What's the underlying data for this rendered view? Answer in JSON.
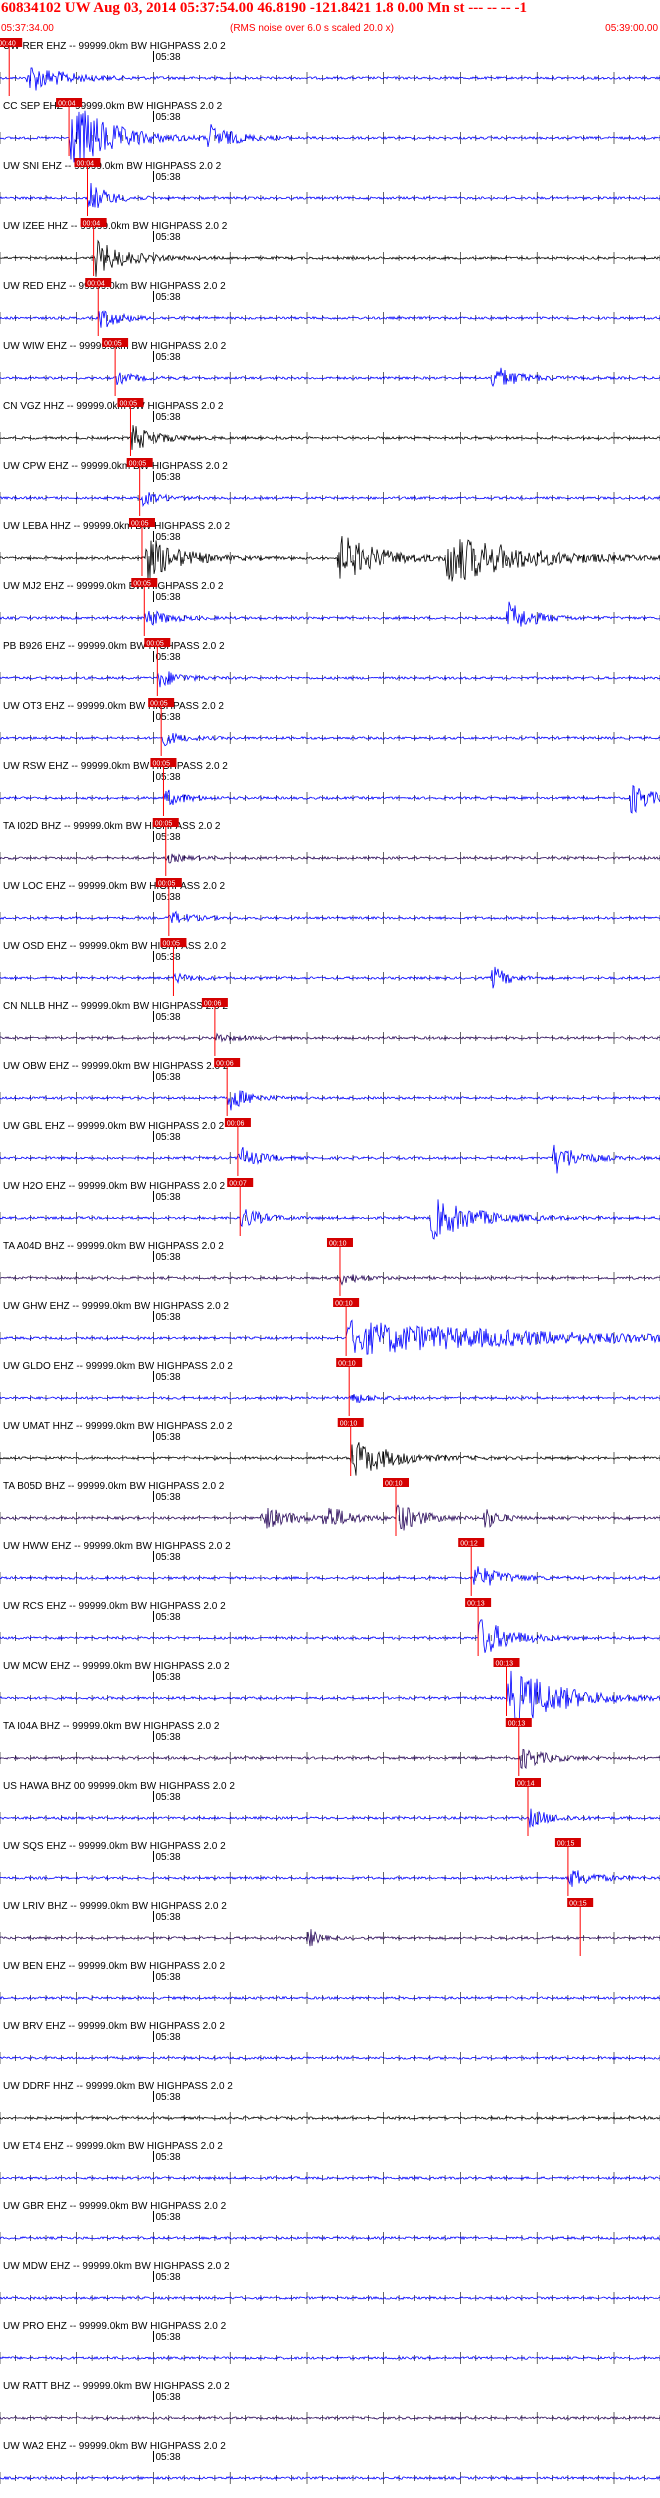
{
  "header": {
    "title": "60834102 UW Aug 03, 2014 05:37:54.00  46.8190 -121.8421  1.8 0.00 Mn st --- -- --  -1",
    "start_time": "05:37:34.00",
    "note": "(RMS noise over 6.0 s scaled 20.0 x)",
    "end_time": "05:39:00.00"
  },
  "colors": {
    "pick": "#ff0000",
    "pick_fill": "#d40000",
    "grid": "#000000",
    "traces": {
      "blue": "#0000ff",
      "black": "#000000",
      "purple": "#2a0a5c"
    }
  },
  "chart_data": {
    "type": "line",
    "title": "60834102 UW Aug 03, 2014 05:37:54.00  46.8190 -121.8421  1.8 0.00 Mn st --- -- --  -1",
    "x_range": [
      "05:37:34.00",
      "05:39:00.00"
    ],
    "tick_label": "05:38",
    "grid": "vertical ticks every 2 s, labeled minute mark",
    "channels": [
      {
        "label": "UW RER EHZ -- 99999.0km BW  HIGHPASS  2.0  2",
        "pick": "00:40",
        "pick_s": 1.2,
        "color": "blue",
        "events": [
          {
            "t": 3.5,
            "amp": 1.0,
            "dur": 7
          }
        ]
      },
      {
        "label": "CC SEP EHZ -- 99999.0km BW  HIGHPASS  2.0  2",
        "pick": "00:04",
        "pick_s": 9.0,
        "color": "blue",
        "events": [
          {
            "t": 9.0,
            "amp": 2.6,
            "dur": 8
          },
          {
            "t": 27,
            "amp": 0.9,
            "dur": 5
          }
        ]
      },
      {
        "label": "UW SNI EHZ -- 99999.0km BW  HIGHPASS  2.0  2",
        "pick": "00:04",
        "pick_s": 11.4,
        "color": "blue",
        "events": [
          {
            "t": 11.4,
            "amp": 1.1,
            "dur": 4
          }
        ]
      },
      {
        "label": "UW IZEE HHZ -- 99999.0km BW  HIGHPASS  2.0  2",
        "pick": "00:04",
        "pick_s": 12.2,
        "color": "black",
        "events": [
          {
            "t": 12.2,
            "amp": 1.2,
            "dur": 6
          }
        ]
      },
      {
        "label": "UW RED EHZ -- 99999.0km BW  HIGHPASS  2.0  2",
        "pick": "00:04",
        "pick_s": 12.8,
        "color": "blue",
        "events": [
          {
            "t": 12.8,
            "amp": 0.8,
            "dur": 4
          }
        ]
      },
      {
        "label": "UW WIW EHZ -- 99999.0km BW  HIGHPASS  2.0  2",
        "pick": "00:05",
        "pick_s": 15.0,
        "color": "blue",
        "events": [
          {
            "t": 15.0,
            "amp": 0.4,
            "dur": 4
          },
          {
            "t": 64,
            "amp": 0.9,
            "dur": 5
          }
        ]
      },
      {
        "label": "CN VGZ HHZ -- 99999.0km BW  HIGHPASS  2.0  2",
        "pick": "00:05",
        "pick_s": 17.0,
        "color": "black",
        "events": [
          {
            "t": 17.0,
            "amp": 0.9,
            "dur": 5
          }
        ]
      },
      {
        "label": "UW CPW EHZ -- 99999.0km BW  HIGHPASS  2.0  2",
        "pick": "00:05",
        "pick_s": 18.2,
        "color": "blue",
        "events": [
          {
            "t": 18.2,
            "amp": 0.5,
            "dur": 4
          }
        ]
      },
      {
        "label": "UW LEBA HHZ -- 99999.0km BW  HIGHPASS  2.0  2",
        "pick": "00:05",
        "pick_s": 18.5,
        "color": "black",
        "events": [
          {
            "t": 18.5,
            "amp": 1.6,
            "dur": 7
          },
          {
            "t": 44,
            "amp": 1.6,
            "dur": 8
          },
          {
            "t": 58,
            "amp": 1.7,
            "dur": 15
          }
        ]
      },
      {
        "label": "UW MJ2 EHZ -- 99999.0km BW  HIGHPASS  2.0  2",
        "pick": "00:05",
        "pick_s": 18.8,
        "color": "blue",
        "events": [
          {
            "t": 18.8,
            "amp": 0.6,
            "dur": 5
          },
          {
            "t": 66,
            "amp": 1.1,
            "dur": 5
          }
        ]
      },
      {
        "label": "PB B926 EHZ -- 99999.0km BW  HIGHPASS  2.0  2",
        "pick": "00:05",
        "pick_s": 20.5,
        "color": "blue",
        "events": [
          {
            "t": 20.5,
            "amp": 0.7,
            "dur": 4
          }
        ]
      },
      {
        "label": "UW OT3 EHZ -- 99999.0km BW  HIGHPASS  2.0  2",
        "pick": "00:05",
        "pick_s": 21.0,
        "color": "blue",
        "events": [
          {
            "t": 21.0,
            "amp": 0.5,
            "dur": 4
          }
        ]
      },
      {
        "label": "UW RSW EHZ -- 99999.0km BW  HIGHPASS  2.0  2",
        "pick": "00:05",
        "pick_s": 21.3,
        "color": "blue",
        "events": [
          {
            "t": 21.3,
            "amp": 0.6,
            "dur": 4
          },
          {
            "t": 82,
            "amp": 1.2,
            "dur": 4
          }
        ]
      },
      {
        "label": "TA I02D BHZ -- 99999.0km BW  HIGHPASS  2.0  2",
        "pick": "00:05",
        "pick_s": 21.6,
        "color": "purple",
        "events": [
          {
            "t": 21.6,
            "amp": 0.3,
            "dur": 4
          }
        ]
      },
      {
        "label": "UW LOC EHZ -- 99999.0km BW  HIGHPASS  2.0  2",
        "pick": "00:05",
        "pick_s": 22.0,
        "color": "blue",
        "events": [
          {
            "t": 22.0,
            "amp": 0.5,
            "dur": 4
          }
        ]
      },
      {
        "label": "UW OSD EHZ -- 99999.0km BW  HIGHPASS  2.0  2",
        "pick": "00:05",
        "pick_s": 22.6,
        "color": "blue",
        "events": [
          {
            "t": 22.6,
            "amp": 0.3,
            "dur": 4
          },
          {
            "t": 64,
            "amp": 0.9,
            "dur": 3
          }
        ]
      },
      {
        "label": "CN NLLB HHZ -- 99999.0km BW  HIGHPASS  2.0  2",
        "pick": "00:06",
        "pick_s": 28.0,
        "color": "purple",
        "events": [
          {
            "t": 28.0,
            "amp": 0.3,
            "dur": 4
          }
        ]
      },
      {
        "label": "UW OBW EHZ -- 99999.0km BW  HIGHPASS  2.0  2",
        "pick": "00:06",
        "pick_s": 29.6,
        "color": "blue",
        "events": [
          {
            "t": 29.6,
            "amp": 0.9,
            "dur": 4
          }
        ]
      },
      {
        "label": "UW GBL EHZ -- 99999.0km BW  HIGHPASS  2.0  2",
        "pick": "00:06",
        "pick_s": 31.0,
        "color": "blue",
        "events": [
          {
            "t": 31.0,
            "amp": 0.8,
            "dur": 4
          },
          {
            "t": 72,
            "amp": 1.1,
            "dur": 5
          }
        ]
      },
      {
        "label": "UW H2O EHZ -- 99999.0km BW  HIGHPASS  2.0  2",
        "pick": "00:07",
        "pick_s": 31.3,
        "color": "blue",
        "events": [
          {
            "t": 31.3,
            "amp": 0.8,
            "dur": 4
          },
          {
            "t": 56,
            "amp": 1.4,
            "dur": 9
          }
        ]
      },
      {
        "label": "TA A04D BHZ -- 99999.0km BW  HIGHPASS  2.0  2",
        "pick": "00:10",
        "pick_s": 44.3,
        "color": "purple",
        "events": [
          {
            "t": 44.3,
            "amp": 0.4,
            "dur": 4
          }
        ]
      },
      {
        "label": "UW GHW EHZ -- 99999.0km BW  HIGHPASS  2.0  2",
        "pick": "00:10",
        "pick_s": 45.1,
        "color": "blue",
        "events": [
          {
            "t": 45.1,
            "amp": 1.1,
            "dur": 40
          }
        ]
      },
      {
        "label": "UW GLDO EHZ -- 99999.0km BW  HIGHPASS  2.0  2",
        "pick": "00:10",
        "pick_s": 45.5,
        "color": "blue",
        "events": [
          {
            "t": 45.5,
            "amp": 0.4,
            "dur": 4
          }
        ]
      },
      {
        "label": "UW UMAT HHZ -- 99999.0km BW  HIGHPASS  2.0  2",
        "pick": "00:10",
        "pick_s": 45.7,
        "color": "black",
        "events": [
          {
            "t": 45.7,
            "amp": 1.3,
            "dur": 8
          }
        ]
      },
      {
        "label": "TA B05D BHZ -- 99999.0km BW  HIGHPASS  2.0  2",
        "pick": "00:10",
        "pick_s": 51.6,
        "color": "purple",
        "events": [
          {
            "t": 34,
            "amp": 0.8,
            "dur": 6
          },
          {
            "t": 42,
            "amp": 0.9,
            "dur": 5
          },
          {
            "t": 51.6,
            "amp": 1.0,
            "dur": 5
          },
          {
            "t": 63,
            "amp": 0.8,
            "dur": 3
          }
        ]
      },
      {
        "label": "UW HWW EHZ -- 99999.0km BW  HIGHPASS  2.0  2",
        "pick": "00:12",
        "pick_s": 61.4,
        "color": "blue",
        "events": [
          {
            "t": 61.4,
            "amp": 0.9,
            "dur": 6
          }
        ]
      },
      {
        "label": "UW RCS EHZ -- 99999.0km BW  HIGHPASS  2.0  2",
        "pick": "00:13",
        "pick_s": 62.3,
        "color": "blue",
        "events": [
          {
            "t": 62.3,
            "amp": 1.4,
            "dur": 6
          }
        ]
      },
      {
        "label": "UW MCW EHZ -- 99999.0km BW  HIGHPASS  2.0  2",
        "pick": "00:13",
        "pick_s": 66.0,
        "color": "blue",
        "events": [
          {
            "t": 66.0,
            "amp": 2.2,
            "dur": 10
          }
        ]
      },
      {
        "label": "TA I04A BHZ -- 99999.0km BW  HIGHPASS  2.0  2",
        "pick": "00:13",
        "pick_s": 67.6,
        "color": "purple",
        "events": [
          {
            "t": 67.6,
            "amp": 0.8,
            "dur": 5
          }
        ]
      },
      {
        "label": "US HAWA BHZ 00 99999.0km BW  HIGHPASS  2.0  2",
        "pick": "00:14",
        "pick_s": 68.8,
        "color": "blue",
        "events": [
          {
            "t": 68.8,
            "amp": 0.6,
            "dur": 5
          }
        ]
      },
      {
        "label": "UW SQS EHZ -- 99999.0km BW  HIGHPASS  2.0  2",
        "pick": "00:15",
        "pick_s": 74.0,
        "color": "blue",
        "events": [
          {
            "t": 74.0,
            "amp": 0.7,
            "dur": 5
          }
        ]
      },
      {
        "label": "UW LRIV BHZ -- 99999.0km BW  HIGHPASS  2.0  2",
        "pick": "00:15",
        "pick_s": 75.6,
        "color": "purple",
        "events": [
          {
            "t": 40,
            "amp": 0.8,
            "dur": 2
          }
        ]
      },
      {
        "label": "UW BEN EHZ -- 99999.0km BW  HIGHPASS  2.0  2",
        "pick": "",
        "pick_s": null,
        "color": "blue",
        "events": []
      },
      {
        "label": "UW BRV EHZ -- 99999.0km BW  HIGHPASS  2.0  2",
        "pick": "",
        "pick_s": null,
        "color": "blue",
        "events": []
      },
      {
        "label": "UW DDRF HHZ -- 99999.0km BW  HIGHPASS  2.0  2",
        "pick": "",
        "pick_s": null,
        "color": "black",
        "events": []
      },
      {
        "label": "UW ET4 EHZ -- 99999.0km BW  HIGHPASS  2.0  2",
        "pick": "",
        "pick_s": null,
        "color": "blue",
        "events": []
      },
      {
        "label": "UW GBR EHZ -- 99999.0km BW  HIGHPASS  2.0  2",
        "pick": "",
        "pick_s": null,
        "color": "blue",
        "events": []
      },
      {
        "label": "UW MDW EHZ -- 99999.0km BW  HIGHPASS  2.0  2",
        "pick": "",
        "pick_s": null,
        "color": "blue",
        "events": []
      },
      {
        "label": "UW PRO EHZ -- 99999.0km BW  HIGHPASS  2.0  2",
        "pick": "",
        "pick_s": null,
        "color": "blue",
        "events": []
      },
      {
        "label": "UW RATT BHZ -- 99999.0km BW  HIGHPASS  2.0  2",
        "pick": "",
        "pick_s": null,
        "color": "purple",
        "events": []
      },
      {
        "label": "UW WA2 EHZ -- 99999.0km BW  HIGHPASS  2.0  2",
        "pick": "",
        "pick_s": null,
        "color": "blue",
        "events": []
      }
    ]
  }
}
